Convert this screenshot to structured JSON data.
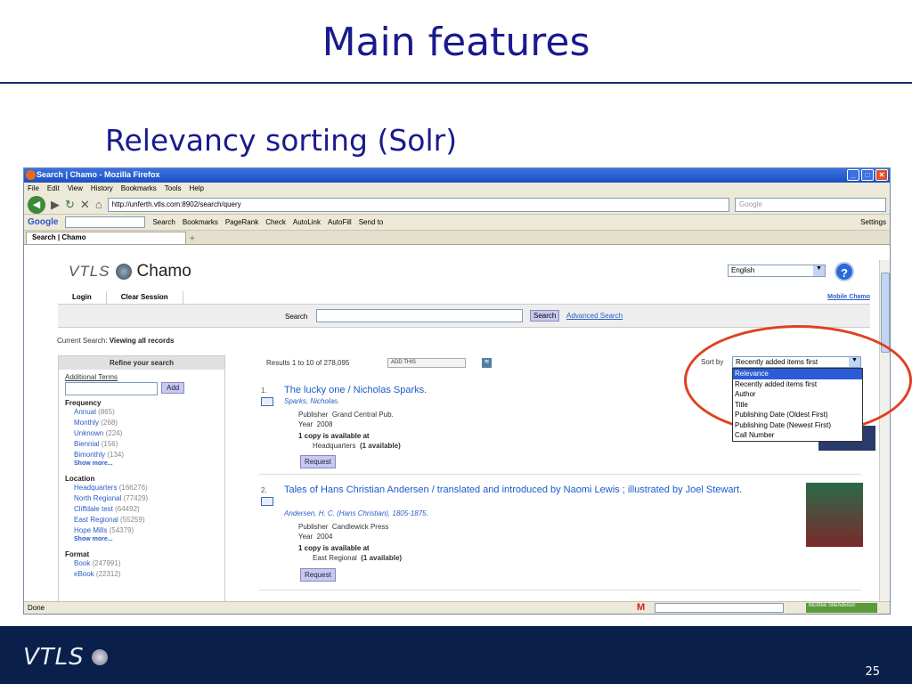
{
  "slide": {
    "title": "Main features",
    "subtitle": "Relevancy sorting (Solr)",
    "page_number": "25",
    "footer_logo_text": "VTLS"
  },
  "browser": {
    "window_title": "Search | Chamo - Mozilla Firefox",
    "menu": [
      "File",
      "Edit",
      "View",
      "History",
      "Bookmarks",
      "Tools",
      "Help"
    ],
    "url": "http://unferth.vtls.com:8902/search/query",
    "search_engine_placeholder": "Google",
    "toolbar_items": [
      "Search",
      "Bookmarks",
      "PageRank",
      "Check",
      "AutoLink",
      "AutoFill",
      "Send to",
      "Settings"
    ],
    "google_label": "Google",
    "tab_label": "Search | Chamo",
    "status_text": "Done",
    "mcafee_label": "McAfee SiteAdvisor"
  },
  "chamo": {
    "logo_vtls": "VTLS",
    "logo_chamo": "Chamo",
    "language": "English",
    "nav": [
      "Login",
      "Clear Session"
    ],
    "mobile_link": "Mobile Chamo",
    "search_label": "Search",
    "search_button": "Search",
    "advanced_search": "Advanced Search",
    "current_search_label": "Current Search:",
    "current_search_value": "Viewing all records",
    "refine_header": "Refine your search",
    "additional_terms_label": "Additional Terms",
    "add_button": "Add",
    "facets": [
      {
        "title": "Frequency",
        "items": [
          {
            "label": "Annual",
            "count": "(865)"
          },
          {
            "label": "Monthly",
            "count": "(268)"
          },
          {
            "label": "Unknown",
            "count": "(224)"
          },
          {
            "label": "Biennial",
            "count": "(156)"
          },
          {
            "label": "Bimonthly",
            "count": "(134)"
          }
        ],
        "more": "Show more..."
      },
      {
        "title": "Location",
        "items": [
          {
            "label": "Headquarters",
            "count": "(166276)"
          },
          {
            "label": "North Regional",
            "count": "(77429)"
          },
          {
            "label": "Cliffdale test",
            "count": "(64492)"
          },
          {
            "label": "East Regional",
            "count": "(55259)"
          },
          {
            "label": "Hope Mills",
            "count": "(54379)"
          }
        ],
        "more": "Show more..."
      },
      {
        "title": "Format",
        "items": [
          {
            "label": "Book",
            "count": "(247991)"
          },
          {
            "label": "eBook",
            "count": "(22312)"
          }
        ],
        "more": ""
      }
    ],
    "results_summary": "Results 1 to 10 of 278,095",
    "addthis_label": "ADD THIS",
    "sort_label": "Sort by",
    "sort_selected": "Recently added items first",
    "sort_options": [
      "Relevance",
      "Recently added items first",
      "Author",
      "Title",
      "Publishing Date (Oldest First)",
      "Publishing Date (Newest First)",
      "Call Number"
    ],
    "sort_highlighted": "Relevance",
    "records": [
      {
        "number": "1.",
        "title": "The lucky one / Nicholas Sparks.",
        "author": "Sparks, Nicholas.",
        "publisher_label": "Publisher",
        "publisher": "Grand Central Pub.",
        "year_label": "Year",
        "year": "2008",
        "copy_text": "1 copy is available at",
        "location": "Headquarters",
        "availability": "(1 available)",
        "request": "Request"
      },
      {
        "number": "2.",
        "title": "Tales of Hans Christian Andersen / translated and introduced by Naomi Lewis ; illustrated by Joel Stewart.",
        "author": "Andersen, H. C. (Hans Christian), 1805-1875.",
        "publisher_label": "Publisher",
        "publisher": "Candlewick Press",
        "year_label": "Year",
        "year": "2004",
        "copy_text": "1 copy is available at",
        "location": "East Regional",
        "availability": "(1 available)",
        "request": "Request"
      }
    ]
  },
  "colors": {
    "title": "#1a1a8e",
    "highlight_oval": "#e04020",
    "footer_bar": "#0a1f4a",
    "link": "#2a5cc8",
    "selected_option": "#2a5cd8"
  }
}
